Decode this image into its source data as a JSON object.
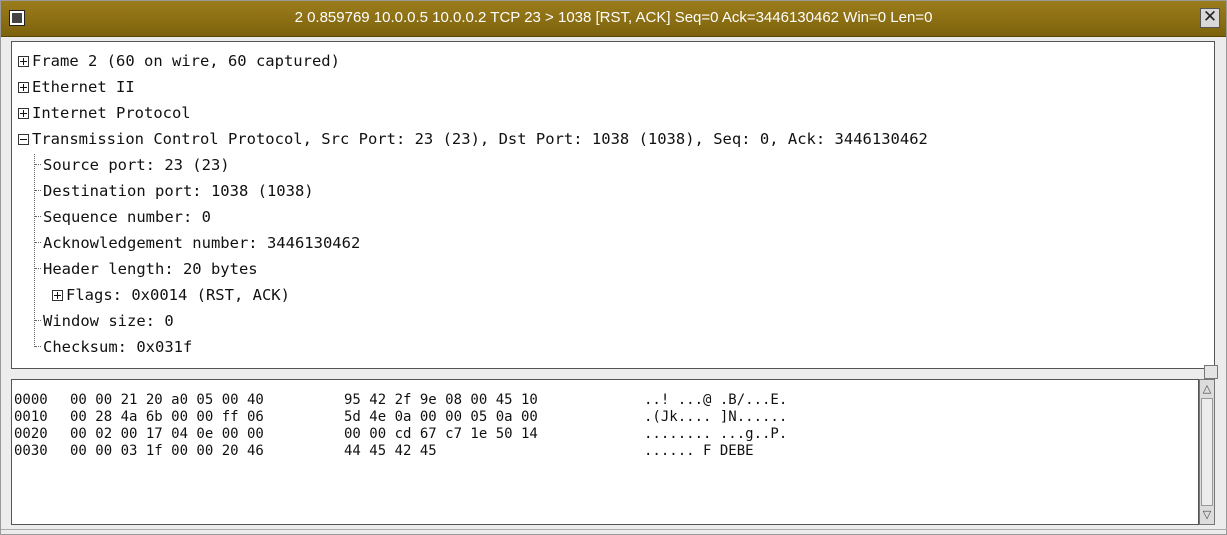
{
  "window": {
    "title": "2 0.859769 10.0.0.5 10.0.0.2 TCP 23 > 1038 [RST, ACK] Seq=0 Ack=3446130462 Win=0 Len=0",
    "close_glyph": "✕"
  },
  "tree": {
    "frame": "Frame 2 (60 on wire, 60 captured)",
    "ethernet": "Ethernet II",
    "ip": "Internet Protocol",
    "tcp": "Transmission Control Protocol, Src Port: 23 (23), Dst Port: 1038 (1038), Seq: 0, Ack: 3446130462",
    "tcp_fields": {
      "source_port": "Source port: 23 (23)",
      "destination_port": "Destination port: 1038 (1038)",
      "sequence_number": "Sequence number: 0",
      "ack_number": "Acknowledgement number: 3446130462",
      "header_length": "Header length: 20 bytes",
      "flags": "Flags: 0x0014 (RST, ACK)",
      "window_size": "Window size: 0",
      "checksum": "Checksum: 0x031f"
    }
  },
  "hex": {
    "rows": [
      {
        "offset": "0000",
        "bytes1": "00 00 21 20 a0 05 00 40",
        "bytes2": "95 42 2f 9e 08 00 45 10",
        "ascii": "..! ...@ .B/...E."
      },
      {
        "offset": "0010",
        "bytes1": "00 28 4a 6b 00 00 ff 06",
        "bytes2": "5d 4e 0a 00 00 05 0a 00",
        "ascii": ".(Jk.... ]N......"
      },
      {
        "offset": "0020",
        "bytes1": "00 02 00 17 04 0e 00 00",
        "bytes2": "00 00 cd 67 c7 1e 50 14",
        "ascii": "........ ...g..P."
      },
      {
        "offset": "0030",
        "bytes1": "00 00 03 1f 00 00 20 46",
        "bytes2": "44 45 42 45",
        "ascii": "...... F DEBE"
      }
    ]
  },
  "scrollbar": {
    "up_arrow": "△",
    "down_arrow": "▽"
  }
}
